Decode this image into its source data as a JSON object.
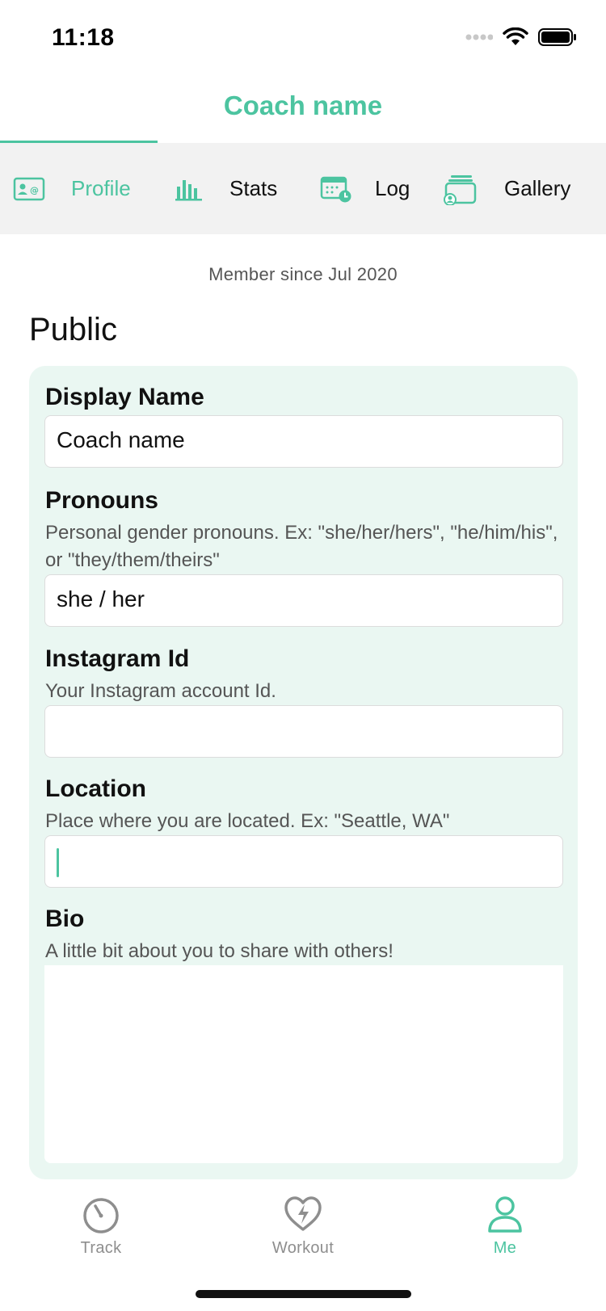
{
  "status_bar": {
    "time": "11:18"
  },
  "header": {
    "title": "Coach name"
  },
  "tabs": [
    {
      "label": "Profile",
      "icon": "contact-card-icon",
      "active": true
    },
    {
      "label": "Stats",
      "icon": "bar-chart-icon",
      "active": false
    },
    {
      "label": "Log",
      "icon": "calendar-clock-icon",
      "active": false
    },
    {
      "label": "Gallery",
      "icon": "gallery-user-icon",
      "active": false
    }
  ],
  "member_since": "Member since Jul 2020",
  "section": {
    "title": "Public"
  },
  "fields": {
    "display_name": {
      "label": "Display Name",
      "value": "Coach name"
    },
    "pronouns": {
      "label": "Pronouns",
      "help": "Personal gender pronouns. Ex: \"she/her/hers\", \"he/him/his\", or \"they/them/theirs\"",
      "value": "she / her"
    },
    "instagram": {
      "label": "Instagram Id",
      "help": "Your Instagram account Id.",
      "value": ""
    },
    "location": {
      "label": "Location",
      "help": "Place where you are located. Ex: \"Seattle, WA\"",
      "value": ""
    },
    "bio": {
      "label": "Bio",
      "help": "A little bit about you to share with others!",
      "value": ""
    }
  },
  "bottom_nav": [
    {
      "label": "Track",
      "icon": "stopwatch-icon",
      "active": false
    },
    {
      "label": "Workout",
      "icon": "heart-bolt-icon",
      "active": false
    },
    {
      "label": "Me",
      "icon": "person-icon",
      "active": true
    }
  ],
  "colors": {
    "accent": "#4cc4a0",
    "card_bg": "#eaf7f2",
    "tab_bg": "#f2f2f2",
    "inactive": "#8e8e8e"
  }
}
